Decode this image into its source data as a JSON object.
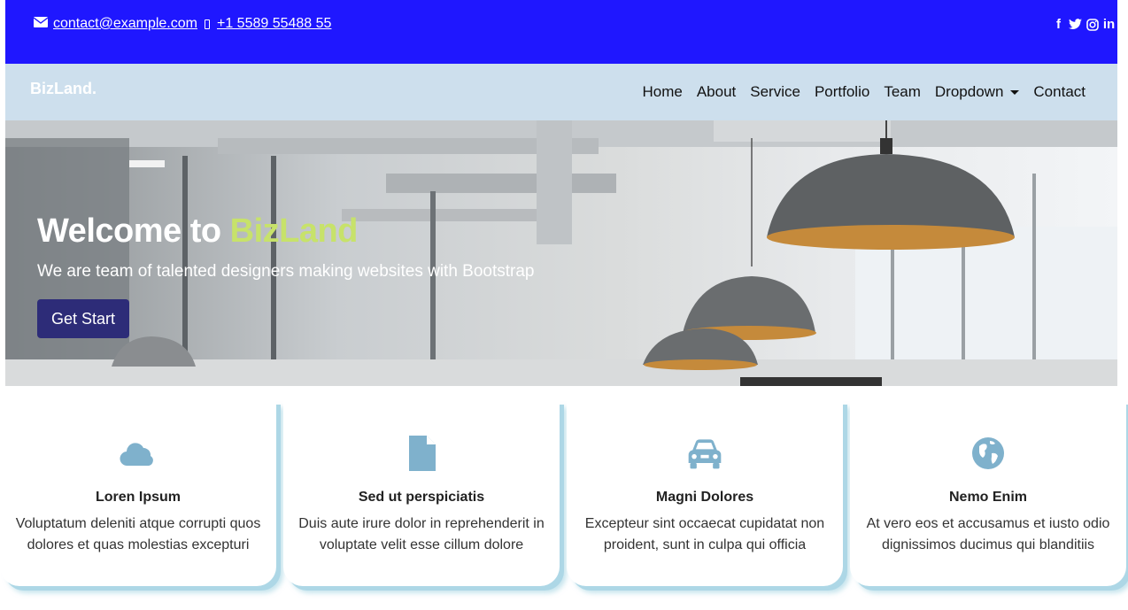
{
  "topbar": {
    "email": "contact@example.com",
    "phone": "+1 5589 55488 55",
    "social": [
      "f",
      "t",
      "i",
      "in"
    ]
  },
  "navbar": {
    "logo": "BizLand.",
    "menu": [
      "Home",
      "About",
      "Service",
      "Portfolio",
      "Team",
      "Dropdown",
      "Contact"
    ]
  },
  "hero": {
    "title_prefix": "Welcome to",
    "title_brand": "BizLand",
    "subtitle": "We are team of talented designers making websites with Bootstrap",
    "cta": "Get Start"
  },
  "features": [
    {
      "icon": "cloud-icon",
      "title": "Loren Ipsum",
      "desc": "Voluptatum deleniti atque corrupti quos dolores et quas molestias excepturi"
    },
    {
      "icon": "document-icon",
      "title": "Sed ut perspiciatis",
      "desc": "Duis aute irure dolor in reprehenderit in voluptate velit esse cillum dolore"
    },
    {
      "icon": "car-icon",
      "title": "Magni Dolores",
      "desc": "Excepteur sint occaecat cupidatat non proident, sunt in culpa qui officia"
    },
    {
      "icon": "globe-icon",
      "title": "Nemo Enim",
      "desc": "At vero eos et accusamus et iusto odio dignissimos ducimus qui blanditiis"
    }
  ],
  "colors": {
    "topbar_bg": "#1f17ff",
    "navbar_bg": "#cddfed",
    "brand_accent": "#c7e26a",
    "button_bg": "#2d2c78",
    "icon_color": "#7fb1cc",
    "card_shadow": "#add7e6"
  }
}
